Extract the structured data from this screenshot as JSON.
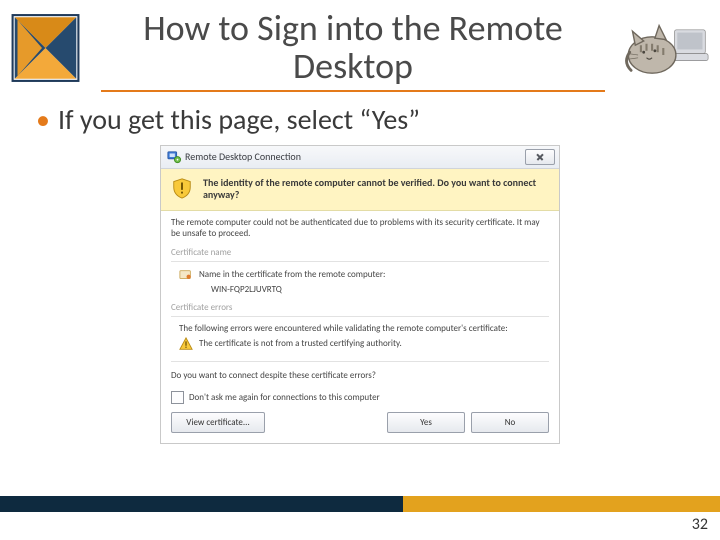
{
  "slide": {
    "title": "How to Sign into the Remote Desktop",
    "bullet": "If you get this page, select “Yes”",
    "page_number": "32"
  },
  "dialog": {
    "window_title": "Remote Desktop Connection",
    "warn_line": "The identity of the remote computer cannot be verified. Do you want to connect anyway?",
    "explain": "The remote computer could not be authenticated due to problems with its security certificate. It may be unsafe to proceed.",
    "cert_name_label": "Certificate name",
    "cert_name_line": "Name in the certificate from the remote computer:",
    "cert_name_value": "WIN-FQP2LJUVRTQ",
    "cert_errors_label": "Certificate errors",
    "cert_errors_line": "The following errors were encountered while validating the remote computer's certificate:",
    "cert_error_item": "The certificate is not from a trusted certifying authority.",
    "question": "Do you want to connect despite these certificate errors?",
    "checkbox_label": "Don't ask me again for connections to this computer",
    "buttons": {
      "view": "View certificate...",
      "yes": "Yes",
      "no": "No"
    }
  }
}
